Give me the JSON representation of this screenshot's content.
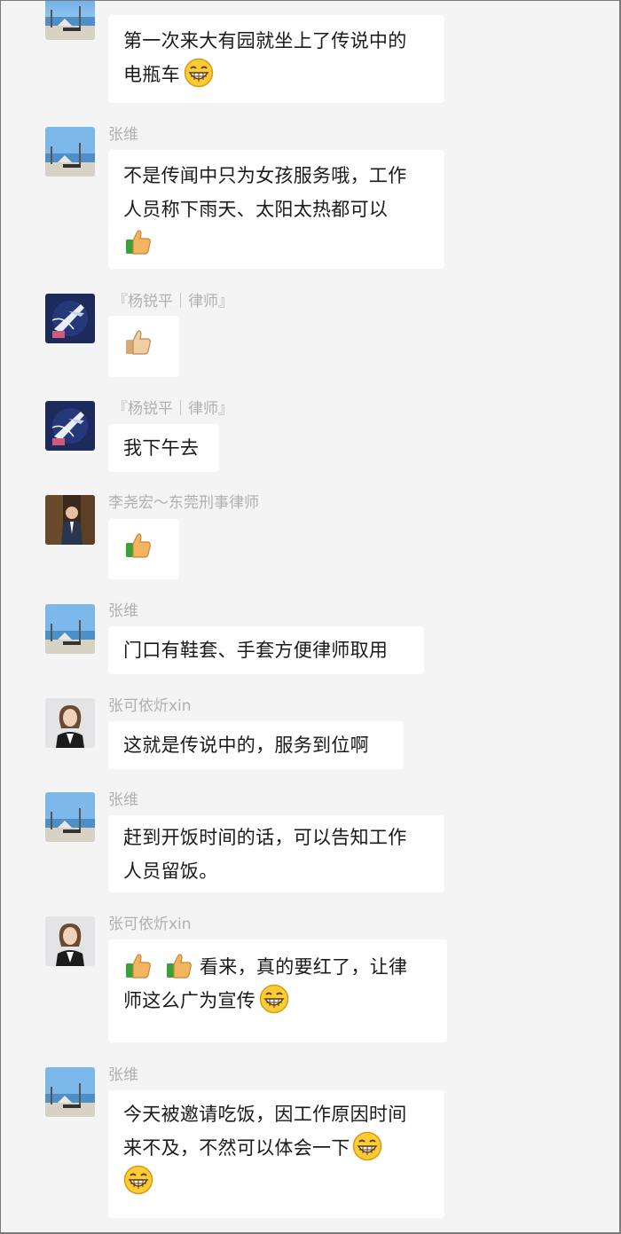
{
  "messages": [
    {
      "sender": "",
      "lines": [
        "第一次来大有园就坐上了传说中的",
        "电瓶车"
      ],
      "avatar": "beach-avatar",
      "tail_emoji": "grin"
    },
    {
      "sender": "张维",
      "lines": [
        "不是传闻中只为女孩服务哦，工作",
        "人员称下雨天、太阳太热都可以"
      ],
      "avatar": "beach-avatar",
      "extra_line_emoji": [
        "thumbs-up"
      ]
    },
    {
      "sender": "『杨锐平｜律师』",
      "lines": [],
      "avatar": "airplane-avatar",
      "extra_line_emoji": [
        "thumbs-up-light"
      ]
    },
    {
      "sender": "『杨锐平｜律师』",
      "lines": [
        "我下午去"
      ],
      "avatar": "airplane-avatar"
    },
    {
      "sender": "李尧宏～东莞刑事律师",
      "lines": [],
      "avatar": "portrait-avatar",
      "extra_line_emoji": [
        "thumbs-up"
      ]
    },
    {
      "sender": "张维",
      "lines": [
        "门口有鞋套、手套方便律师取用"
      ],
      "avatar": "beach-avatar"
    },
    {
      "sender": "张可依炘xin",
      "lines": [
        "这就是传说中的，服务到位啊"
      ],
      "avatar": "woman-avatar"
    },
    {
      "sender": "张维",
      "lines": [
        "赶到开饭时间的话，可以告知工作",
        "人员留饭。"
      ],
      "avatar": "beach-avatar"
    },
    {
      "sender": "张可依炘xin",
      "lines": [
        "看来，真的要红了，让律",
        "师这么广为宣传"
      ],
      "avatar": "woman-avatar",
      "lead_emoji": [
        "thumbs-up",
        "thumbs-up"
      ],
      "tail_emoji": "grin"
    },
    {
      "sender": "张维",
      "lines": [
        "今天被邀请吃饭，因工作原因时间",
        "来不及，不然可以体会一下"
      ],
      "avatar": "beach-avatar",
      "tail_emoji": "grin",
      "extra_line_emoji": [
        "grin"
      ]
    }
  ]
}
